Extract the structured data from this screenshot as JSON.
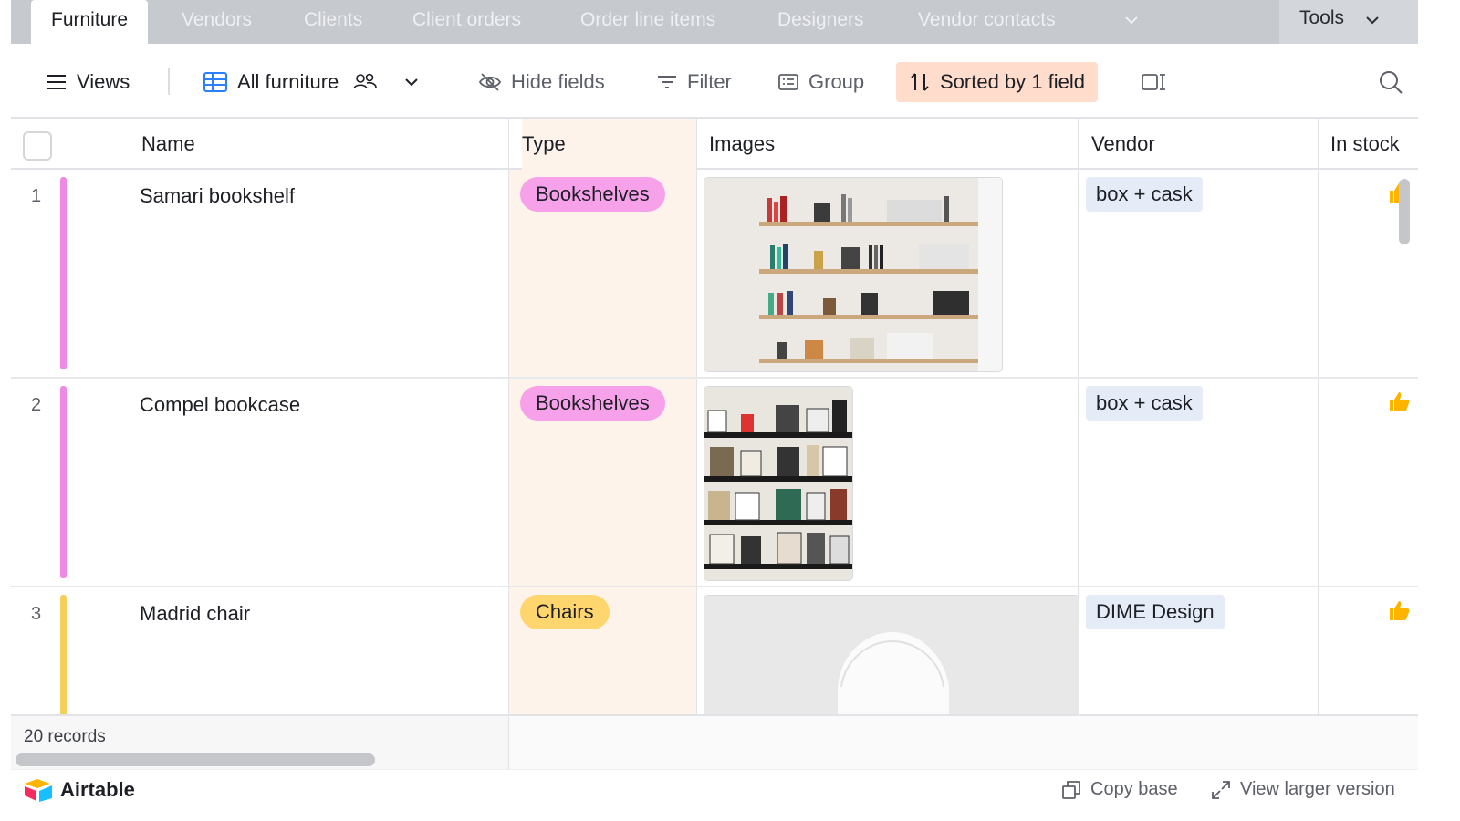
{
  "tabs": [
    {
      "label": "Furniture",
      "active": true
    },
    {
      "label": "Vendors",
      "active": false
    },
    {
      "label": "Clients",
      "active": false
    },
    {
      "label": "Client orders",
      "active": false
    },
    {
      "label": "Order line items",
      "active": false
    },
    {
      "label": "Designers",
      "active": false
    },
    {
      "label": "Vendor contacts",
      "active": false
    }
  ],
  "tools_label": "Tools",
  "toolbar": {
    "views_label": "Views",
    "view_name": "All furniture",
    "hide_fields_label": "Hide fields",
    "filter_label": "Filter",
    "group_label": "Group",
    "sort_label": "Sorted by 1 field"
  },
  "columns": {
    "name": "Name",
    "type": "Type",
    "images": "Images",
    "vendor": "Vendor",
    "in_stock": "In stock"
  },
  "rows": [
    {
      "num": "1",
      "name": "Samari bookshelf",
      "type": "Bookshelves",
      "type_color": "#f7a1ea",
      "vendor": "box + cask",
      "in_stock": true,
      "bar_color": "#ee8ae3"
    },
    {
      "num": "2",
      "name": "Compel bookcase",
      "type": "Bookshelves",
      "type_color": "#f7a1ea",
      "vendor": "box + cask",
      "in_stock": true,
      "bar_color": "#ee8ae3"
    },
    {
      "num": "3",
      "name": "Madrid chair",
      "type": "Chairs",
      "type_color": "#ffd66e",
      "vendor": "DIME Design",
      "in_stock": true,
      "bar_color": "#f5cf5a"
    }
  ],
  "footer": {
    "records": "20 records"
  },
  "bottom": {
    "brand": "Airtable",
    "copy_base": "Copy base",
    "view_larger": "View larger version"
  },
  "colors": {
    "accent_sort": "#ffdccb",
    "type_column_bg": "#fef3ea",
    "vendor_chip": "#e5ecf7",
    "thumbs_up": "#fcb400"
  }
}
